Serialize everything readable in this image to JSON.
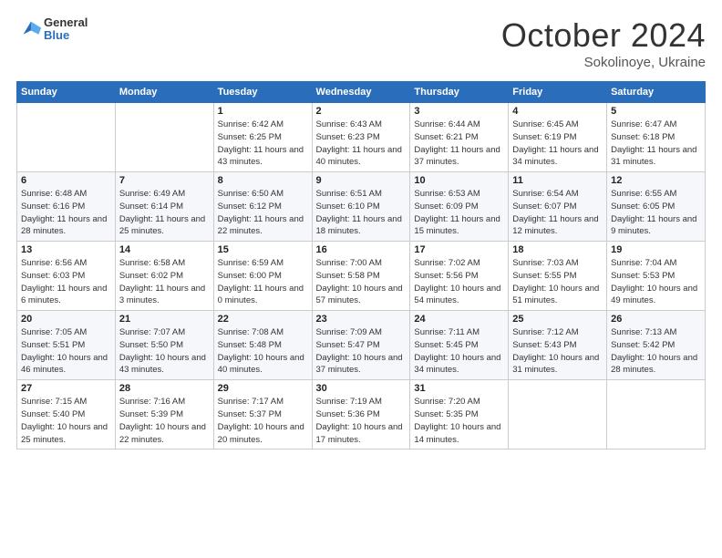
{
  "logo": {
    "line1": "General",
    "line2": "Blue"
  },
  "title": "October 2024",
  "location": "Sokolinoye, Ukraine",
  "days_header": [
    "Sunday",
    "Monday",
    "Tuesday",
    "Wednesday",
    "Thursday",
    "Friday",
    "Saturday"
  ],
  "weeks": [
    [
      {
        "day": "",
        "sunrise": "",
        "sunset": "",
        "daylight": ""
      },
      {
        "day": "",
        "sunrise": "",
        "sunset": "",
        "daylight": ""
      },
      {
        "day": "1",
        "sunrise": "Sunrise: 6:42 AM",
        "sunset": "Sunset: 6:25 PM",
        "daylight": "Daylight: 11 hours and 43 minutes."
      },
      {
        "day": "2",
        "sunrise": "Sunrise: 6:43 AM",
        "sunset": "Sunset: 6:23 PM",
        "daylight": "Daylight: 11 hours and 40 minutes."
      },
      {
        "day": "3",
        "sunrise": "Sunrise: 6:44 AM",
        "sunset": "Sunset: 6:21 PM",
        "daylight": "Daylight: 11 hours and 37 minutes."
      },
      {
        "day": "4",
        "sunrise": "Sunrise: 6:45 AM",
        "sunset": "Sunset: 6:19 PM",
        "daylight": "Daylight: 11 hours and 34 minutes."
      },
      {
        "day": "5",
        "sunrise": "Sunrise: 6:47 AM",
        "sunset": "Sunset: 6:18 PM",
        "daylight": "Daylight: 11 hours and 31 minutes."
      }
    ],
    [
      {
        "day": "6",
        "sunrise": "Sunrise: 6:48 AM",
        "sunset": "Sunset: 6:16 PM",
        "daylight": "Daylight: 11 hours and 28 minutes."
      },
      {
        "day": "7",
        "sunrise": "Sunrise: 6:49 AM",
        "sunset": "Sunset: 6:14 PM",
        "daylight": "Daylight: 11 hours and 25 minutes."
      },
      {
        "day": "8",
        "sunrise": "Sunrise: 6:50 AM",
        "sunset": "Sunset: 6:12 PM",
        "daylight": "Daylight: 11 hours and 22 minutes."
      },
      {
        "day": "9",
        "sunrise": "Sunrise: 6:51 AM",
        "sunset": "Sunset: 6:10 PM",
        "daylight": "Daylight: 11 hours and 18 minutes."
      },
      {
        "day": "10",
        "sunrise": "Sunrise: 6:53 AM",
        "sunset": "Sunset: 6:09 PM",
        "daylight": "Daylight: 11 hours and 15 minutes."
      },
      {
        "day": "11",
        "sunrise": "Sunrise: 6:54 AM",
        "sunset": "Sunset: 6:07 PM",
        "daylight": "Daylight: 11 hours and 12 minutes."
      },
      {
        "day": "12",
        "sunrise": "Sunrise: 6:55 AM",
        "sunset": "Sunset: 6:05 PM",
        "daylight": "Daylight: 11 hours and 9 minutes."
      }
    ],
    [
      {
        "day": "13",
        "sunrise": "Sunrise: 6:56 AM",
        "sunset": "Sunset: 6:03 PM",
        "daylight": "Daylight: 11 hours and 6 minutes."
      },
      {
        "day": "14",
        "sunrise": "Sunrise: 6:58 AM",
        "sunset": "Sunset: 6:02 PM",
        "daylight": "Daylight: 11 hours and 3 minutes."
      },
      {
        "day": "15",
        "sunrise": "Sunrise: 6:59 AM",
        "sunset": "Sunset: 6:00 PM",
        "daylight": "Daylight: 11 hours and 0 minutes."
      },
      {
        "day": "16",
        "sunrise": "Sunrise: 7:00 AM",
        "sunset": "Sunset: 5:58 PM",
        "daylight": "Daylight: 10 hours and 57 minutes."
      },
      {
        "day": "17",
        "sunrise": "Sunrise: 7:02 AM",
        "sunset": "Sunset: 5:56 PM",
        "daylight": "Daylight: 10 hours and 54 minutes."
      },
      {
        "day": "18",
        "sunrise": "Sunrise: 7:03 AM",
        "sunset": "Sunset: 5:55 PM",
        "daylight": "Daylight: 10 hours and 51 minutes."
      },
      {
        "day": "19",
        "sunrise": "Sunrise: 7:04 AM",
        "sunset": "Sunset: 5:53 PM",
        "daylight": "Daylight: 10 hours and 49 minutes."
      }
    ],
    [
      {
        "day": "20",
        "sunrise": "Sunrise: 7:05 AM",
        "sunset": "Sunset: 5:51 PM",
        "daylight": "Daylight: 10 hours and 46 minutes."
      },
      {
        "day": "21",
        "sunrise": "Sunrise: 7:07 AM",
        "sunset": "Sunset: 5:50 PM",
        "daylight": "Daylight: 10 hours and 43 minutes."
      },
      {
        "day": "22",
        "sunrise": "Sunrise: 7:08 AM",
        "sunset": "Sunset: 5:48 PM",
        "daylight": "Daylight: 10 hours and 40 minutes."
      },
      {
        "day": "23",
        "sunrise": "Sunrise: 7:09 AM",
        "sunset": "Sunset: 5:47 PM",
        "daylight": "Daylight: 10 hours and 37 minutes."
      },
      {
        "day": "24",
        "sunrise": "Sunrise: 7:11 AM",
        "sunset": "Sunset: 5:45 PM",
        "daylight": "Daylight: 10 hours and 34 minutes."
      },
      {
        "day": "25",
        "sunrise": "Sunrise: 7:12 AM",
        "sunset": "Sunset: 5:43 PM",
        "daylight": "Daylight: 10 hours and 31 minutes."
      },
      {
        "day": "26",
        "sunrise": "Sunrise: 7:13 AM",
        "sunset": "Sunset: 5:42 PM",
        "daylight": "Daylight: 10 hours and 28 minutes."
      }
    ],
    [
      {
        "day": "27",
        "sunrise": "Sunrise: 7:15 AM",
        "sunset": "Sunset: 5:40 PM",
        "daylight": "Daylight: 10 hours and 25 minutes."
      },
      {
        "day": "28",
        "sunrise": "Sunrise: 7:16 AM",
        "sunset": "Sunset: 5:39 PM",
        "daylight": "Daylight: 10 hours and 22 minutes."
      },
      {
        "day": "29",
        "sunrise": "Sunrise: 7:17 AM",
        "sunset": "Sunset: 5:37 PM",
        "daylight": "Daylight: 10 hours and 20 minutes."
      },
      {
        "day": "30",
        "sunrise": "Sunrise: 7:19 AM",
        "sunset": "Sunset: 5:36 PM",
        "daylight": "Daylight: 10 hours and 17 minutes."
      },
      {
        "day": "31",
        "sunrise": "Sunrise: 7:20 AM",
        "sunset": "Sunset: 5:35 PM",
        "daylight": "Daylight: 10 hours and 14 minutes."
      },
      {
        "day": "",
        "sunrise": "",
        "sunset": "",
        "daylight": ""
      },
      {
        "day": "",
        "sunrise": "",
        "sunset": "",
        "daylight": ""
      }
    ]
  ]
}
